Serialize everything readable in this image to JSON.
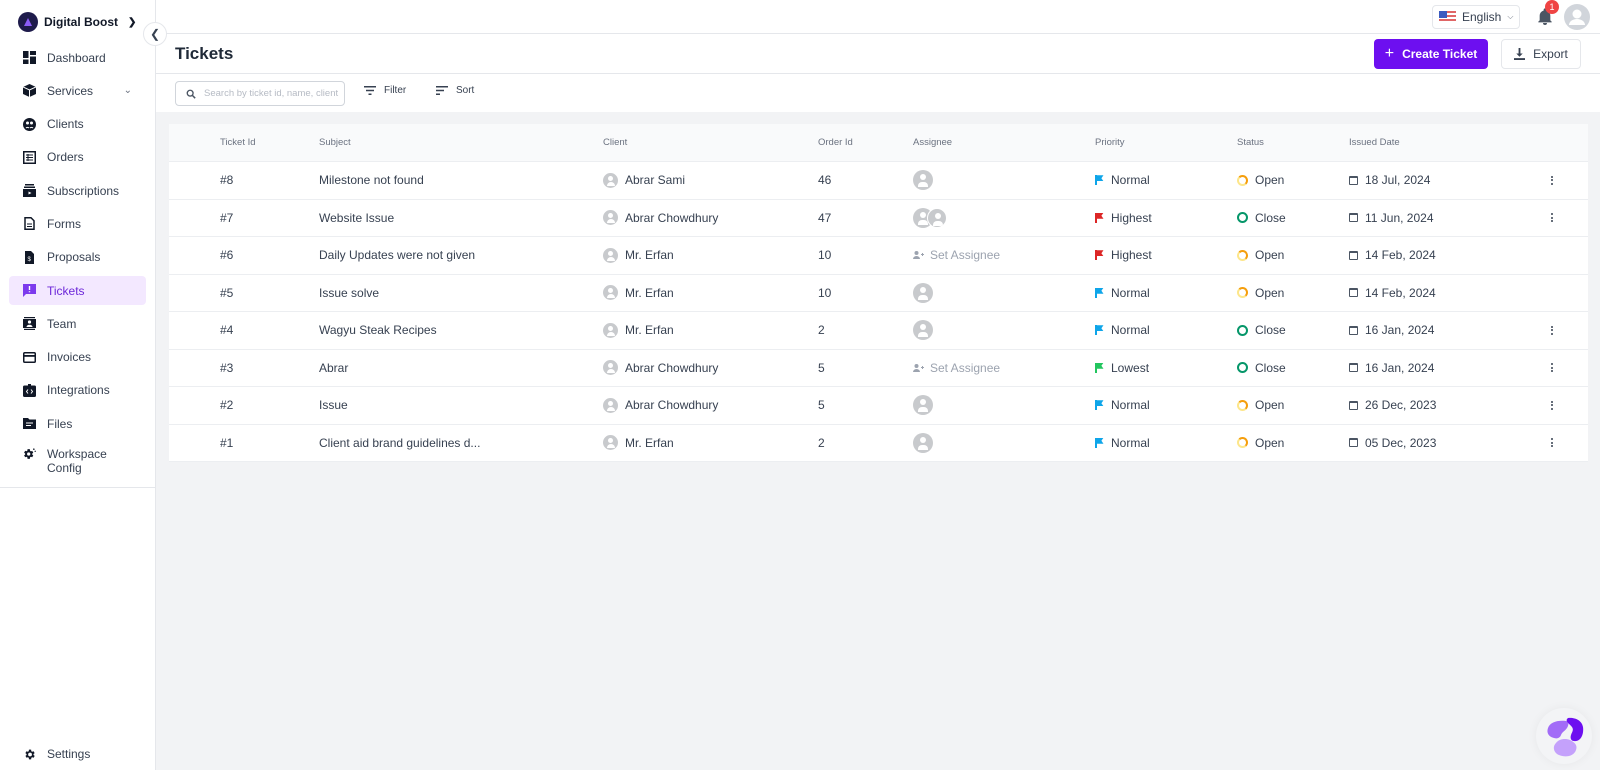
{
  "workspace": {
    "name": "Digital Boost"
  },
  "sidebar": {
    "items": [
      {
        "label": "Dashboard",
        "icon": "dashboard-icon",
        "active": false
      },
      {
        "label": "Services",
        "icon": "box-icon",
        "active": false,
        "has_children": true
      },
      {
        "label": "Clients",
        "icon": "clients-icon",
        "active": false
      },
      {
        "label": "Orders",
        "icon": "orders-icon",
        "active": false
      },
      {
        "label": "Subscriptions",
        "icon": "subscriptions-icon",
        "active": false
      },
      {
        "label": "Forms",
        "icon": "form-icon",
        "active": false
      },
      {
        "label": "Proposals",
        "icon": "proposal-icon",
        "active": false
      },
      {
        "label": "Tickets",
        "icon": "ticket-icon",
        "active": true
      },
      {
        "label": "Team",
        "icon": "team-icon",
        "active": false
      },
      {
        "label": "Invoices",
        "icon": "invoice-icon",
        "active": false
      },
      {
        "label": "Integrations",
        "icon": "integrations-icon",
        "active": false
      },
      {
        "label": "Files",
        "icon": "folder-icon",
        "active": false
      },
      {
        "label": "Workspace Config",
        "label_line1": "Workspace",
        "label_line2": "Config",
        "icon": "workspace-gear-icon",
        "active": false
      }
    ],
    "settings_label": "Settings"
  },
  "topbar": {
    "language": "English",
    "notification_count": "1"
  },
  "header": {
    "title": "Tickets",
    "create_label": "Create Ticket",
    "export_label": "Export"
  },
  "toolbar": {
    "search_placeholder": "Search by ticket id, name, client",
    "filter_label": "Filter",
    "sort_label": "Sort"
  },
  "table": {
    "columns": [
      "Ticket Id",
      "Subject",
      "Client",
      "Order Id",
      "Assignee",
      "Priority",
      "Status",
      "Issued Date"
    ],
    "rows": [
      {
        "id": "#8",
        "subject": "Milestone not found",
        "client": "Abrar Sami",
        "order": "46",
        "assignee": "avatar",
        "priority": "Normal",
        "status": "Open",
        "date": "18 Jul, 2024",
        "menu": true
      },
      {
        "id": "#7",
        "subject": "Website Issue",
        "client": "Abrar Chowdhury",
        "order": "47",
        "assignee": "avatars-2",
        "priority": "Highest",
        "status": "Close",
        "date": "11 Jun, 2024",
        "menu": true
      },
      {
        "id": "#6",
        "subject": "Daily Updates were not given",
        "client": "Mr. Erfan",
        "order": "10",
        "assignee": "Set Assignee",
        "priority": "Highest",
        "status": "Open",
        "date": "14 Feb, 2024",
        "menu": false
      },
      {
        "id": "#5",
        "subject": "Issue solve",
        "client": "Mr. Erfan",
        "order": "10",
        "assignee": "avatar",
        "priority": "Normal",
        "status": "Open",
        "date": "14 Feb, 2024",
        "menu": false
      },
      {
        "id": "#4",
        "subject": "Wagyu Steak Recipes",
        "client": "Mr. Erfan",
        "order": "2",
        "assignee": "avatar",
        "priority": "Normal",
        "status": "Close",
        "date": "16 Jan, 2024",
        "menu": true
      },
      {
        "id": "#3",
        "subject": "Abrar",
        "client": "Abrar Chowdhury",
        "order": "5",
        "assignee": "Set Assignee",
        "priority": "Lowest",
        "status": "Close",
        "date": "16 Jan, 2024",
        "menu": true
      },
      {
        "id": "#2",
        "subject": "Issue",
        "client": "Abrar Chowdhury",
        "order": "5",
        "assignee": "avatar",
        "priority": "Normal",
        "status": "Open",
        "date": "26 Dec, 2023",
        "menu": true
      },
      {
        "id": "#1",
        "subject": "Client aid brand guidelines d...",
        "client": "Mr. Erfan",
        "order": "2",
        "assignee": "avatar",
        "priority": "Normal",
        "status": "Open",
        "date": "05 Dec, 2023",
        "menu": true
      }
    ]
  },
  "colors": {
    "accent": "#6d0ff0",
    "priority_normal": "#0ea5e9",
    "priority_highest": "#dc2626",
    "priority_lowest": "#22c55e",
    "status_close": "#059669",
    "status_open": "#f59e0b"
  }
}
